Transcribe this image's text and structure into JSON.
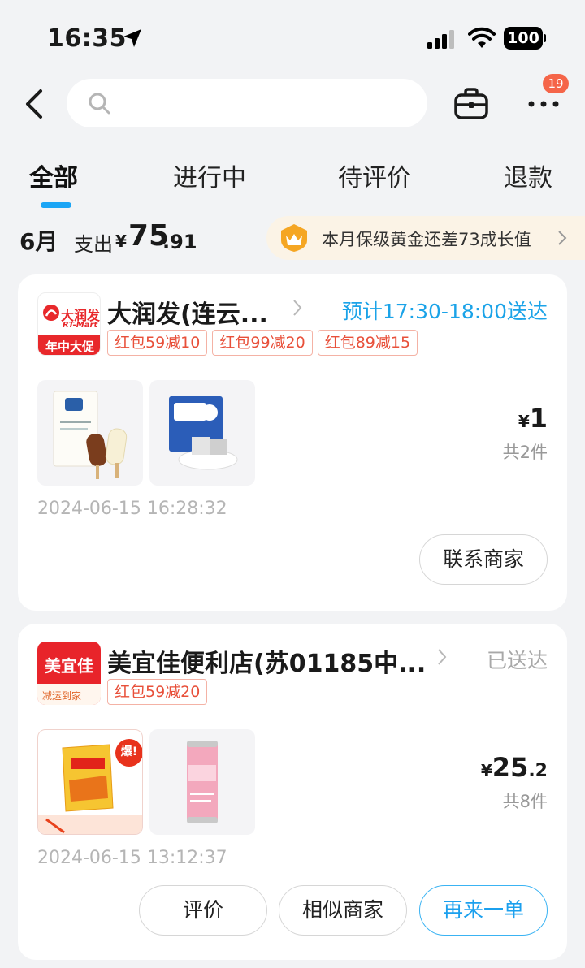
{
  "status_bar": {
    "time": "16:35",
    "battery": "100"
  },
  "header": {
    "search_placeholder": "",
    "notification_count": "19"
  },
  "tabs": [
    {
      "label": "全部",
      "active": true
    },
    {
      "label": "进行中",
      "active": false
    },
    {
      "label": "待评价",
      "active": false
    },
    {
      "label": "退款",
      "active": false
    }
  ],
  "summary": {
    "month": "6月",
    "spend_label": "支出",
    "currency": "¥",
    "spend_int": "75",
    "spend_dec": ".91",
    "member_text": "本月保级黄金还差73成长值"
  },
  "orders": [
    {
      "store_name": "大润发(连云...",
      "logo_brand": "大润发",
      "logo_sub": "RT-Mart",
      "logo_tag": "年中大促",
      "status": "预计17:30-18:00送达",
      "status_color": "#1ba3e8",
      "coupons": [
        "红包59减10",
        "红包99减20",
        "红包89减15"
      ],
      "price_symbol": "¥",
      "price_int": "1",
      "price_dec": "",
      "qty": "共2件",
      "time": "2024-06-15 16:28:32",
      "buttons": [
        "联系商家"
      ]
    },
    {
      "store_name": "美宜佳便利店(苏01185中...",
      "logo_brand": "美宜佳",
      "logo_tag": "减运到家",
      "status": "已送达",
      "status_color": "#a8a8a8",
      "coupons": [
        "红包59减20"
      ],
      "price_symbol": "¥",
      "price_int": "25",
      "price_dec": ".2",
      "qty": "共8件",
      "time": "2024-06-15 13:12:37",
      "product_badge": "爆!",
      "buttons": [
        "评价",
        "相似商家",
        "再来一单"
      ]
    }
  ]
}
